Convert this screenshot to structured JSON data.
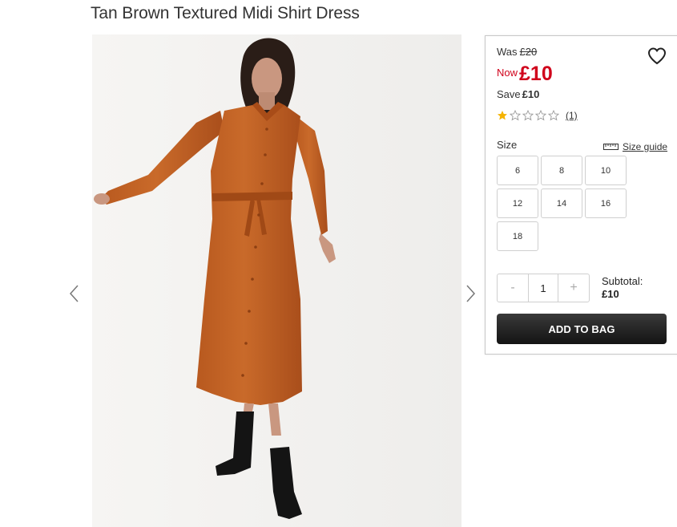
{
  "product": {
    "title": "Tan Brown Textured Midi Shirt Dress"
  },
  "gallery": {
    "prev_icon": "chevron-left-icon",
    "next_icon": "chevron-right-icon",
    "image_subject": "model wearing dress"
  },
  "pricing": {
    "was_label": "Was",
    "was_price": "£20",
    "now_label": "Now",
    "now_price": "£10",
    "save_label": "Save",
    "save_amount": "£10",
    "accent_color": "#d0021b"
  },
  "wishlist": {
    "icon": "heart-icon"
  },
  "rating": {
    "stars_filled": 1,
    "stars_total": 5,
    "review_count": "(1)",
    "star_color": "#f5b301"
  },
  "size": {
    "label": "Size",
    "guide_label": "Size guide",
    "guide_icon": "ruler-icon",
    "options": [
      "6",
      "8",
      "10",
      "12",
      "14",
      "16",
      "18"
    ]
  },
  "quantity": {
    "minus_label": "-",
    "value": "1",
    "plus_label": "+"
  },
  "subtotal": {
    "label": "Subtotal:",
    "amount": "£10"
  },
  "cart": {
    "add_label": "ADD TO BAG"
  }
}
